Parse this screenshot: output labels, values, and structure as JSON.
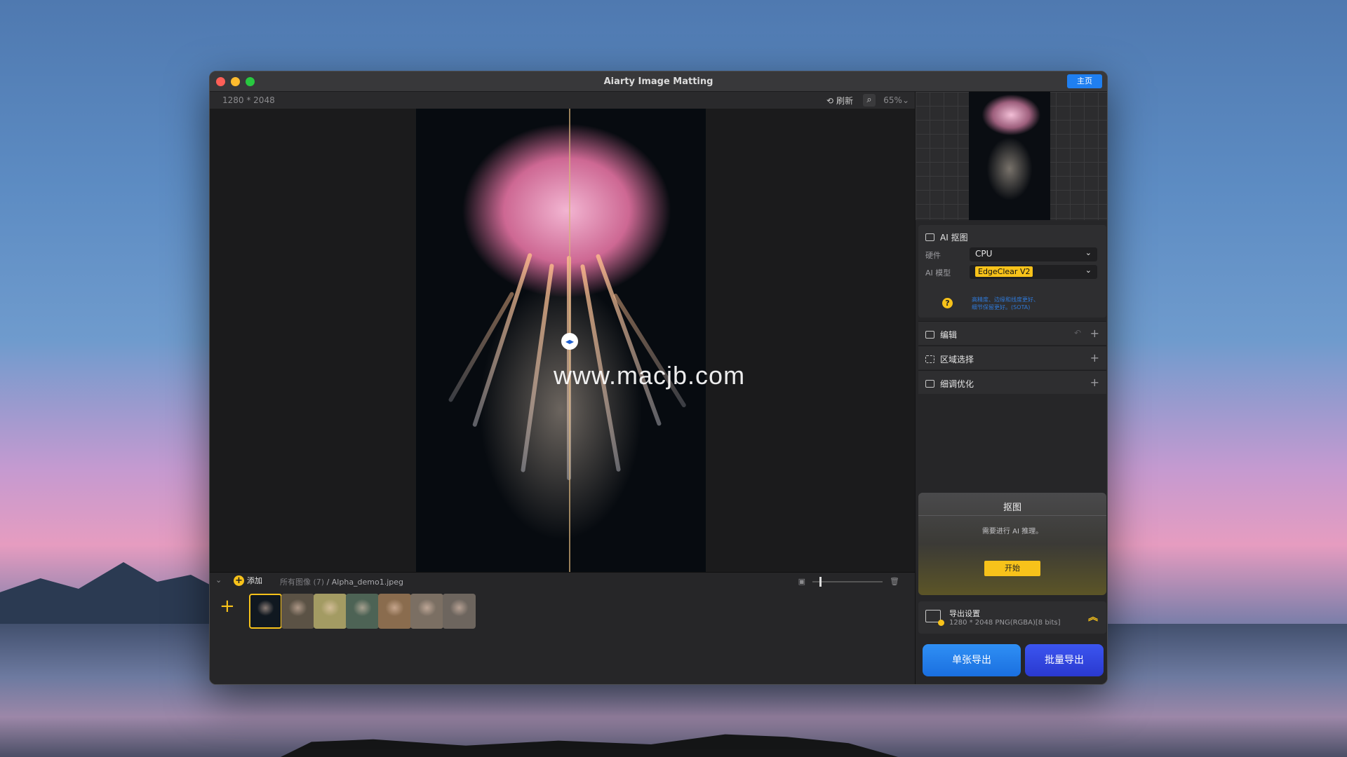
{
  "window": {
    "title": "Aiarty Image Matting",
    "home_label": "主页"
  },
  "toolbar": {
    "dimensions": "1280 * 2048",
    "refresh_label": "刷新",
    "zoom": "65%"
  },
  "canvas": {
    "watermark": "www.macjb.com"
  },
  "filebar": {
    "add_label": "添加",
    "all_images": "所有图像 (7)",
    "current_file": "/ Alpha_demo1.jpeg"
  },
  "thumbnails": [
    {
      "name": "thumb-jellyfish",
      "color": "#101820",
      "selected": true
    },
    {
      "name": "thumb-2",
      "color": "#5b5245"
    },
    {
      "name": "thumb-bicycle",
      "color": "#a39b63"
    },
    {
      "name": "thumb-4",
      "color": "#4d6355"
    },
    {
      "name": "thumb-5",
      "color": "#8a6c4e"
    },
    {
      "name": "thumb-6",
      "color": "#7b6f63"
    },
    {
      "name": "thumb-7",
      "color": "#6d655e"
    }
  ],
  "side": {
    "ai_section": {
      "title": "AI 抠图",
      "hardware_label": "硬件",
      "hardware_value": "CPU",
      "model_label": "AI 模型",
      "model_value": "EdgeClear  V2",
      "help_text_1": "高精度、边缘和线度更好、",
      "help_text_2": "细节保留更好。(SOTA)"
    },
    "sections": [
      {
        "name": "edit",
        "label": "编辑"
      },
      {
        "name": "region-select",
        "label": "区域选择"
      },
      {
        "name": "refine",
        "label": "细调优化"
      }
    ],
    "matting": {
      "title": "抠图",
      "message": "需要进行 AI 推理。",
      "start_label": "开始"
    },
    "export": {
      "title": "导出设置",
      "detail": "1280 * 2048 PNG(RGBA)[8 bits]"
    },
    "buttons": {
      "single_export": "单张导出",
      "batch_export": "批量导出"
    }
  },
  "colors": {
    "accent_yellow": "#f7c21a",
    "accent_blue": "#1f7ff0",
    "batch_blue": "#2a39cf"
  }
}
